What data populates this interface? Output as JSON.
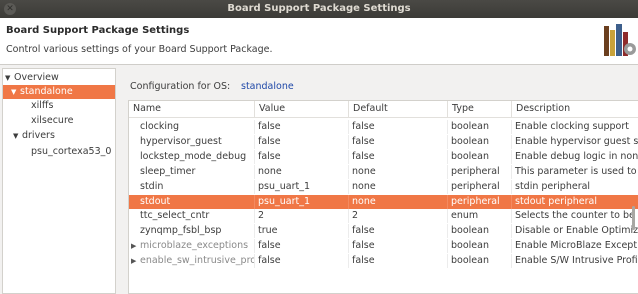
{
  "window": {
    "title": "Board Support Package Settings",
    "close_glyph": "✕"
  },
  "header": {
    "title": "Board Support Package Settings",
    "description": "Control various settings of your Board Support Package."
  },
  "tree": [
    {
      "label": "Overview",
      "arrow": "▼",
      "selected": false
    },
    {
      "label": "standalone",
      "arrow": "▼",
      "selected": true
    },
    {
      "label": "xilffs",
      "arrow": "",
      "selected": false
    },
    {
      "label": "xilsecure",
      "arrow": "",
      "selected": false
    },
    {
      "label": "drivers",
      "arrow": "▼",
      "selected": false
    },
    {
      "label": "psu_cortexa53_0",
      "arrow": "",
      "selected": false
    }
  ],
  "config": {
    "label": "Configuration for OS:",
    "value": "standalone"
  },
  "table": {
    "columns": [
      "Name",
      "Value",
      "Default",
      "Type",
      "Description"
    ],
    "rows": [
      {
        "name": "clocking",
        "value": "false",
        "default": "false",
        "type": "boolean",
        "desc": "Enable clocking support",
        "expandable": false,
        "muted": false,
        "selected": false
      },
      {
        "name": "hypervisor_guest",
        "value": "false",
        "default": "false",
        "type": "boolean",
        "desc": "Enable hypervisor guest su",
        "expandable": false,
        "muted": false,
        "selected": false
      },
      {
        "name": "lockstep_mode_debug",
        "value": "false",
        "default": "false",
        "type": "boolean",
        "desc": "Enable debug logic in non-",
        "expandable": false,
        "muted": false,
        "selected": false
      },
      {
        "name": "sleep_timer",
        "value": "none",
        "default": "none",
        "type": "peripheral",
        "desc": "This parameter is used to",
        "expandable": false,
        "muted": false,
        "selected": false
      },
      {
        "name": "stdin",
        "value": "psu_uart_1",
        "default": "none",
        "type": "peripheral",
        "desc": "stdin peripheral",
        "expandable": false,
        "muted": false,
        "selected": false
      },
      {
        "name": "stdout",
        "value": "psu_uart_1",
        "default": "none",
        "type": "peripheral",
        "desc": "stdout peripheral",
        "expandable": false,
        "muted": false,
        "selected": true
      },
      {
        "name": "ttc_select_cntr",
        "value": "2",
        "default": "2",
        "type": "enum",
        "desc": "Selects the counter to be u",
        "expandable": false,
        "muted": false,
        "selected": false
      },
      {
        "name": "zynqmp_fsbl_bsp",
        "value": "true",
        "default": "false",
        "type": "boolean",
        "desc": "Disable or Enable Optimiz",
        "expandable": false,
        "muted": false,
        "selected": false
      },
      {
        "name": "microblaze_exceptions",
        "value": "false",
        "default": "false",
        "type": "boolean",
        "desc": "Enable MicroBlaze Except",
        "expandable": true,
        "muted": true,
        "selected": false
      },
      {
        "name": "enable_sw_intrusive_profili",
        "value": "false",
        "default": "false",
        "type": "boolean",
        "desc": "Enable S/W Intrusive Profi",
        "expandable": true,
        "muted": true,
        "selected": false
      }
    ]
  },
  "icons": {
    "header_logo": "books-gear-icon",
    "expander": "chevron-right-icon"
  },
  "colors": {
    "selection": "#f07746",
    "config_value": "#1f48a8",
    "titlebar": "#3c3b37"
  }
}
